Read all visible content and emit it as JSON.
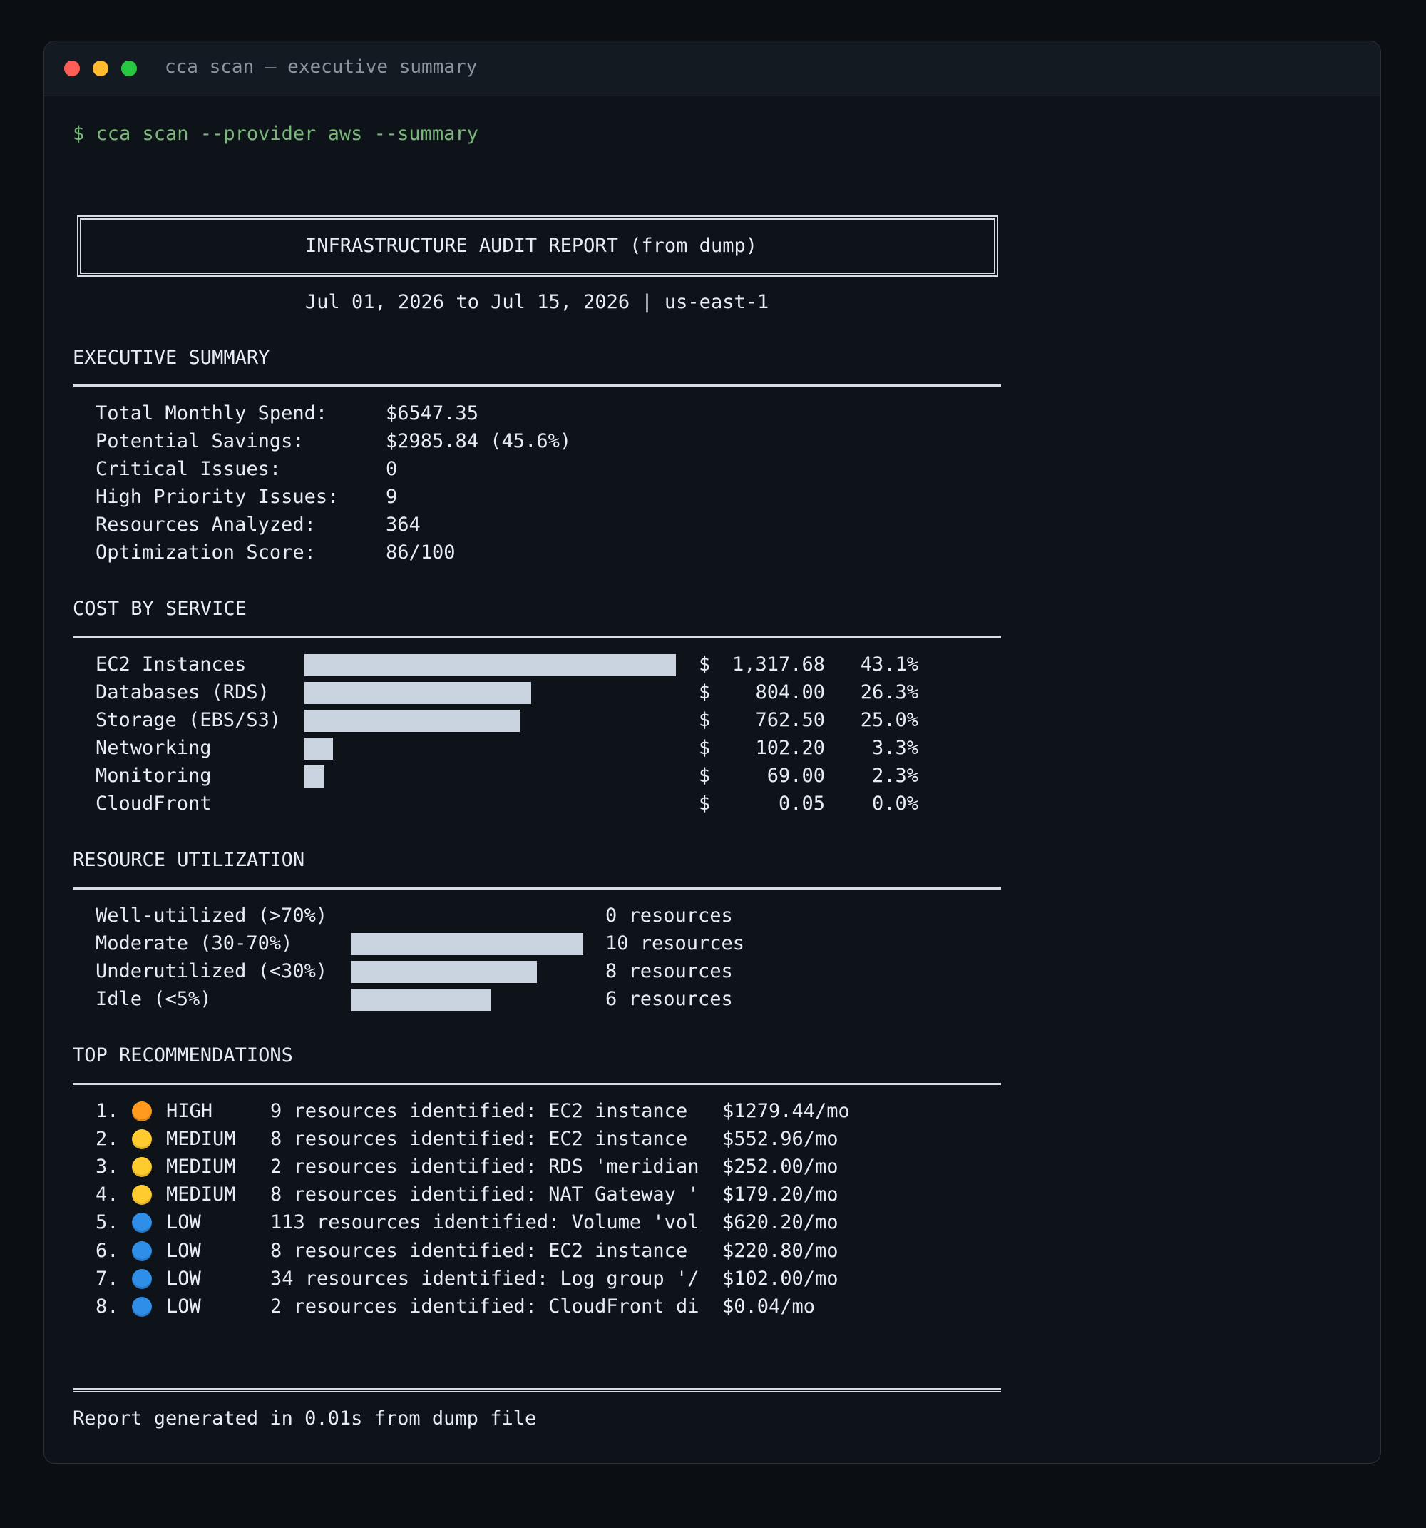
{
  "window": {
    "title": "cca scan — executive summary"
  },
  "command": "$ cca scan --provider aws --summary",
  "report": {
    "title": "INFRASTRUCTURE AUDIT REPORT (from dump)",
    "period": "Jul 01, 2026 to Jul 15, 2026 | us-east-1"
  },
  "executive_summary": {
    "heading": "EXECUTIVE SUMMARY",
    "rows": [
      {
        "label": "Total Monthly Spend:",
        "value": "$6547.35"
      },
      {
        "label": "Potential Savings:",
        "value": "$2985.84 (45.6%)"
      },
      {
        "label": "Critical Issues:",
        "value": "0"
      },
      {
        "label": "High Priority Issues:",
        "value": "9"
      },
      {
        "label": "Resources Analyzed:",
        "value": "364"
      },
      {
        "label": "Optimization Score:",
        "value": "86/100"
      }
    ]
  },
  "cost_by_service": {
    "heading": "COST BY SERVICE",
    "currency_symbol": "$",
    "rows": [
      {
        "service": "EC2 Instances",
        "amount": "1,317.68",
        "percent": "43.1%",
        "share": 0.431
      },
      {
        "service": "Databases (RDS)",
        "amount": "804.00",
        "percent": "26.3%",
        "share": 0.263
      },
      {
        "service": "Storage (EBS/S3)",
        "amount": "762.50",
        "percent": "25.0%",
        "share": 0.25
      },
      {
        "service": "Networking",
        "amount": "102.20",
        "percent": "3.3%",
        "share": 0.033
      },
      {
        "service": "Monitoring",
        "amount": "69.00",
        "percent": "2.3%",
        "share": 0.023
      },
      {
        "service": "CloudFront",
        "amount": "0.05",
        "percent": "0.0%",
        "share": 0.0
      }
    ]
  },
  "resource_utilization": {
    "heading": "RESOURCE UTILIZATION",
    "rows": [
      {
        "label": "Well-utilized (>70%)",
        "count": "0 resources",
        "value": 0
      },
      {
        "label": "Moderate (30-70%)",
        "count": "10 resources",
        "value": 10
      },
      {
        "label": "Underutilized (<30%)",
        "count": "8 resources",
        "value": 8
      },
      {
        "label": "Idle (<5%)",
        "count": "6 resources",
        "value": 6
      }
    ]
  },
  "recommendations": {
    "heading": "TOP RECOMMENDATIONS",
    "items": [
      {
        "num": "1.",
        "icon": "orange-circle-icon",
        "color": "#ff9a1f",
        "priority": "HIGH",
        "text": "9 resources identified: EC2 instance",
        "savings": "$1279.44/mo"
      },
      {
        "num": "2.",
        "icon": "yellow-circle-icon",
        "color": "#ffcb2f",
        "priority": "MEDIUM",
        "text": "8 resources identified: EC2 instance",
        "savings": "$552.96/mo"
      },
      {
        "num": "3.",
        "icon": "yellow-circle-icon",
        "color": "#ffcb2f",
        "priority": "MEDIUM",
        "text": "2 resources identified: RDS 'meridian",
        "savings": "$252.00/mo"
      },
      {
        "num": "4.",
        "icon": "yellow-circle-icon",
        "color": "#ffcb2f",
        "priority": "MEDIUM",
        "text": "8 resources identified: NAT Gateway '",
        "savings": "$179.20/mo"
      },
      {
        "num": "5.",
        "icon": "blue-circle-icon",
        "color": "#2f8fe8",
        "priority": "LOW",
        "text": "113 resources identified: Volume 'vol",
        "savings": "$620.20/mo"
      },
      {
        "num": "6.",
        "icon": "blue-circle-icon",
        "color": "#2f8fe8",
        "priority": "LOW",
        "text": "8 resources identified: EC2 instance",
        "savings": "$220.80/mo"
      },
      {
        "num": "7.",
        "icon": "blue-circle-icon",
        "color": "#2f8fe8",
        "priority": "LOW",
        "text": "34 resources identified: Log group '/",
        "savings": "$102.00/mo"
      },
      {
        "num": "8.",
        "icon": "blue-circle-icon",
        "color": "#2f8fe8",
        "priority": "LOW",
        "text": "2 resources identified: CloudFront di",
        "savings": "$0.04/mo"
      }
    ]
  },
  "footer": "Report generated in 0.01s from dump file"
}
